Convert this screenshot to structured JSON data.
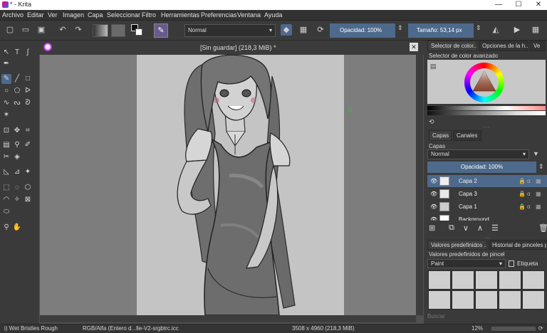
{
  "window": {
    "title": "* - Krita",
    "minimize": "—",
    "maximize": "☐",
    "close": "✕"
  },
  "menu": [
    "Archivo",
    "Editar",
    "Ver",
    "Imagen",
    "Capa",
    "Seleccionar",
    "Filtro",
    "Herramientas",
    "Preferencias",
    "Ventana",
    "Ayuda"
  ],
  "toolbar": {
    "blend_mode": "Normal",
    "opacity": "Opacidad:  100%",
    "size": "Tamaño:  53,14 px"
  },
  "document": {
    "tab_title": "[Sin guardar]  (218,3 MiB) *"
  },
  "dock": {
    "color_tabs": [
      "Selector de color...",
      "Opciones de la h...",
      "Ve"
    ],
    "color_title": "Selector de color avanzado",
    "layer_tabs": [
      "Capas",
      "Canales"
    ],
    "layers_title": "Capas",
    "blend_mode": "Normal",
    "opacity": "Opacidad:  100%",
    "layers": [
      {
        "name": "Capa 2",
        "selected": true
      },
      {
        "name": "Capa 3",
        "selected": false
      },
      {
        "name": "Capa 1",
        "selected": false
      },
      {
        "name": "Background",
        "selected": false
      }
    ],
    "brush_tabs": [
      "Valores predefinidos ...",
      "Historial de pinceles pre..."
    ],
    "brush_title": "Valores predefinidos de pincel",
    "brush_tag": "Paint",
    "tag_label": "Etiqueta",
    "search_placeholder": "Buscar"
  },
  "status": {
    "brush": "i) Wet Bristles Rough",
    "colorspace": "RGB/Alfa (Entero d...lle-V2-srgbtrc.icc",
    "dimensions": "3508 x 4960 (218,3 MiB)",
    "zoom": "12%"
  }
}
